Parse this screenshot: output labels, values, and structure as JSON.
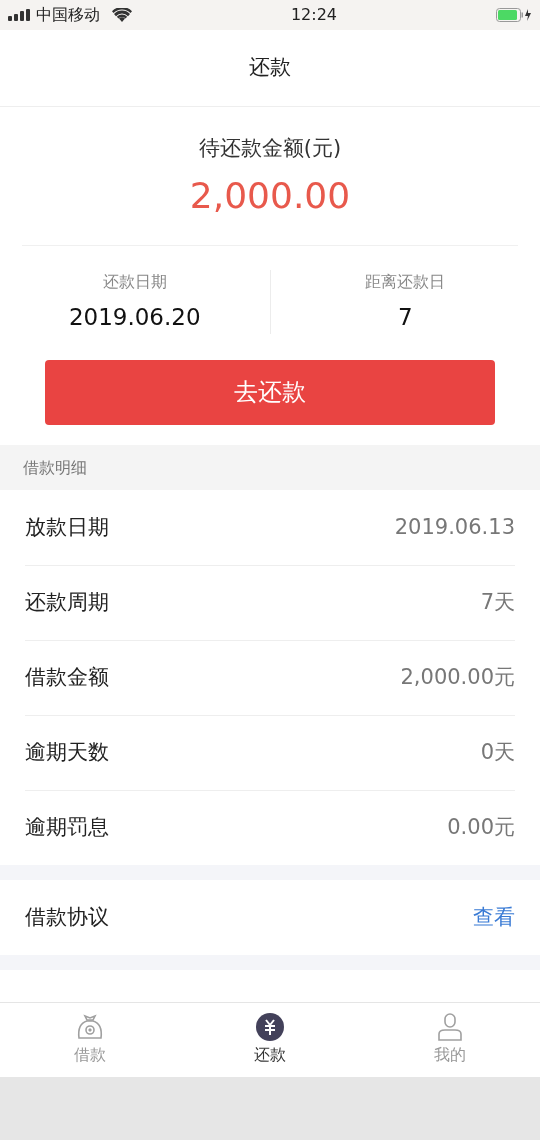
{
  "status_bar": {
    "carrier": "中国移动",
    "time": "12:24"
  },
  "nav": {
    "title": "还款"
  },
  "summary": {
    "label": "待还款金额(元)",
    "amount": "2,000.00",
    "stats": [
      {
        "label": "还款日期",
        "value": "2019.06.20"
      },
      {
        "label": "距离还款日",
        "value": "7"
      }
    ],
    "button": "去还款"
  },
  "details": {
    "header": "借款明细",
    "rows": [
      {
        "label": "放款日期",
        "value": "2019.06.13"
      },
      {
        "label": "还款周期",
        "value": "7天"
      },
      {
        "label": "借款金额",
        "value": "2,000.00元"
      },
      {
        "label": "逾期天数",
        "value": "0天"
      },
      {
        "label": "逾期罚息",
        "value": "0.00元"
      }
    ]
  },
  "agreement": {
    "label": "借款协议",
    "link": "查看"
  },
  "tab_bar": [
    {
      "label": "借款",
      "selected": false
    },
    {
      "label": "还款",
      "selected": true
    },
    {
      "label": "我的",
      "selected": false
    }
  ]
}
